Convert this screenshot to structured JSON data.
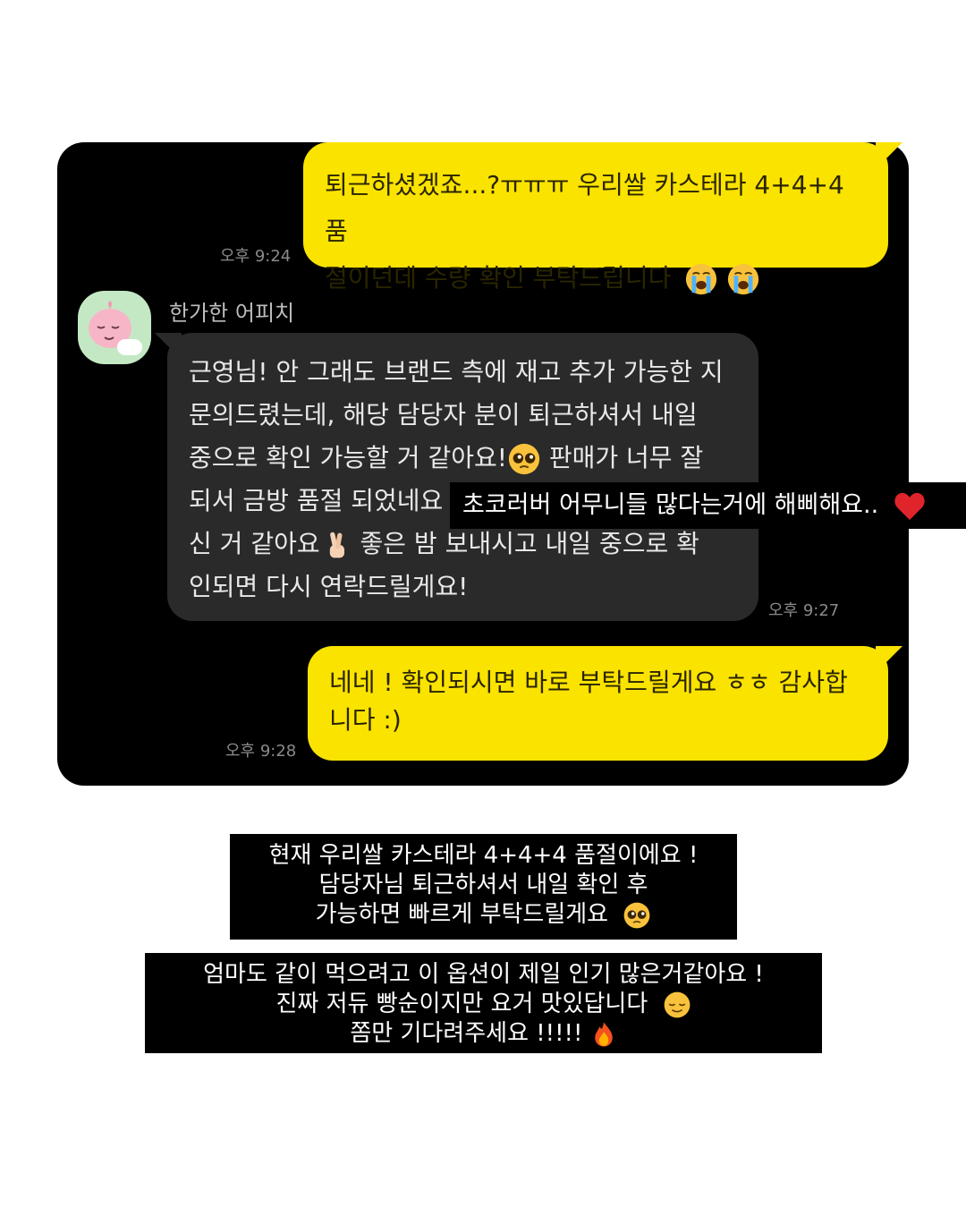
{
  "messages": [
    {
      "id": "m1",
      "direction": "outgoing",
      "lines": [
        "퇴근하셨겠죠...?ㅠㅠㅠ 우리쌀 카스테라 4+4+4 품",
        "절이던데 수량 확인 부탁드립니다"
      ],
      "emojis": [
        "loudly-crying-face",
        "loudly-crying-face"
      ],
      "time": "오후 9:24"
    },
    {
      "id": "m2",
      "direction": "incoming",
      "sender": "한가한 어피치",
      "avatar_icon": "apeach-character-icon",
      "lines": [
        "근영님! 안 그래도 브랜드 측에 재고 추가 가능한 지",
        "문의드렸는데, 해당 담당자 분이 퇴근하셔서 내일",
        "중으로 확인 가능할 거 같아요!",
        "되서 금방 품절 되었네요",
        "신 거 같아요",
        "인되면 다시 연락드릴게요!"
      ],
      "line3_after_emoji": " 판매가 너무 잘",
      "line5_after_emoji": " 좋은 밤 보내시고 내일 중으로 확",
      "emojis": [
        "pleading-face",
        "crossed-fingers"
      ],
      "time": "오후 9:27"
    },
    {
      "id": "m3",
      "direction": "outgoing",
      "lines": [
        "네네 ! 확인되시면 바로 부탁드릴게요 ㅎㅎ 감사합",
        "니다 :)"
      ],
      "time": "오후 9:28"
    }
  ],
  "overlay_text": "초코러버 어무니들 많다는거에 해삐해요..",
  "overlay_icon": "red-heart-icon",
  "captions": [
    {
      "lines": [
        "현재 우리쌀 카스테라 4+4+4 품절이에요 !",
        "담당자님 퇴근하셔서 내일 확인 후",
        "가능하면 빠르게 부탁드릴게요"
      ],
      "emoji": "pleading-face"
    },
    {
      "lines": [
        "엄마도 같이 먹으려고 이 옵션이 제일 인기 많은거같아요 !",
        "진짜 저듀 빵순이지만 요거 맛있답니다",
        "쫌만 기다려주세요 !!!!!"
      ],
      "emojis": [
        "relieved-face",
        "fire"
      ]
    }
  ],
  "colors": {
    "background": "#ffffff",
    "chat_panel": "#000000",
    "outgoing_bubble": "#fbe300",
    "incoming_bubble": "#2a2a2a",
    "timestamp": "#8a8a8a",
    "heart": "#e0242c"
  }
}
